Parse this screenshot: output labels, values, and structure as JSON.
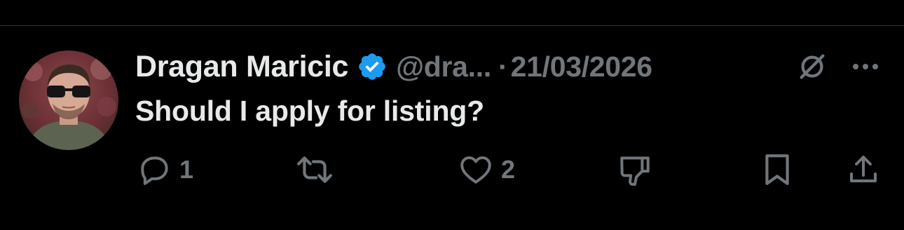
{
  "tweet": {
    "author_name": "Dragan Maricic",
    "handle": "@dra...",
    "separator": "·",
    "date": "21/03/2026",
    "text": "Should I apply for listing?",
    "verified_color": "#1d9bf0"
  },
  "icons": {
    "verified": "verified-badge-icon",
    "grok": "grok-icon",
    "more": "more-icon",
    "reply": "reply-icon",
    "retweet": "retweet-icon",
    "like": "heart-icon",
    "dislike": "thumbs-down-icon",
    "bookmark": "bookmark-icon",
    "share": "share-icon"
  },
  "actions": {
    "reply_count": "1",
    "like_count": "2"
  },
  "colors": {
    "background": "#000000",
    "text_primary": "#e7e9ea",
    "text_secondary": "#71767b",
    "divider": "#2f3336"
  }
}
